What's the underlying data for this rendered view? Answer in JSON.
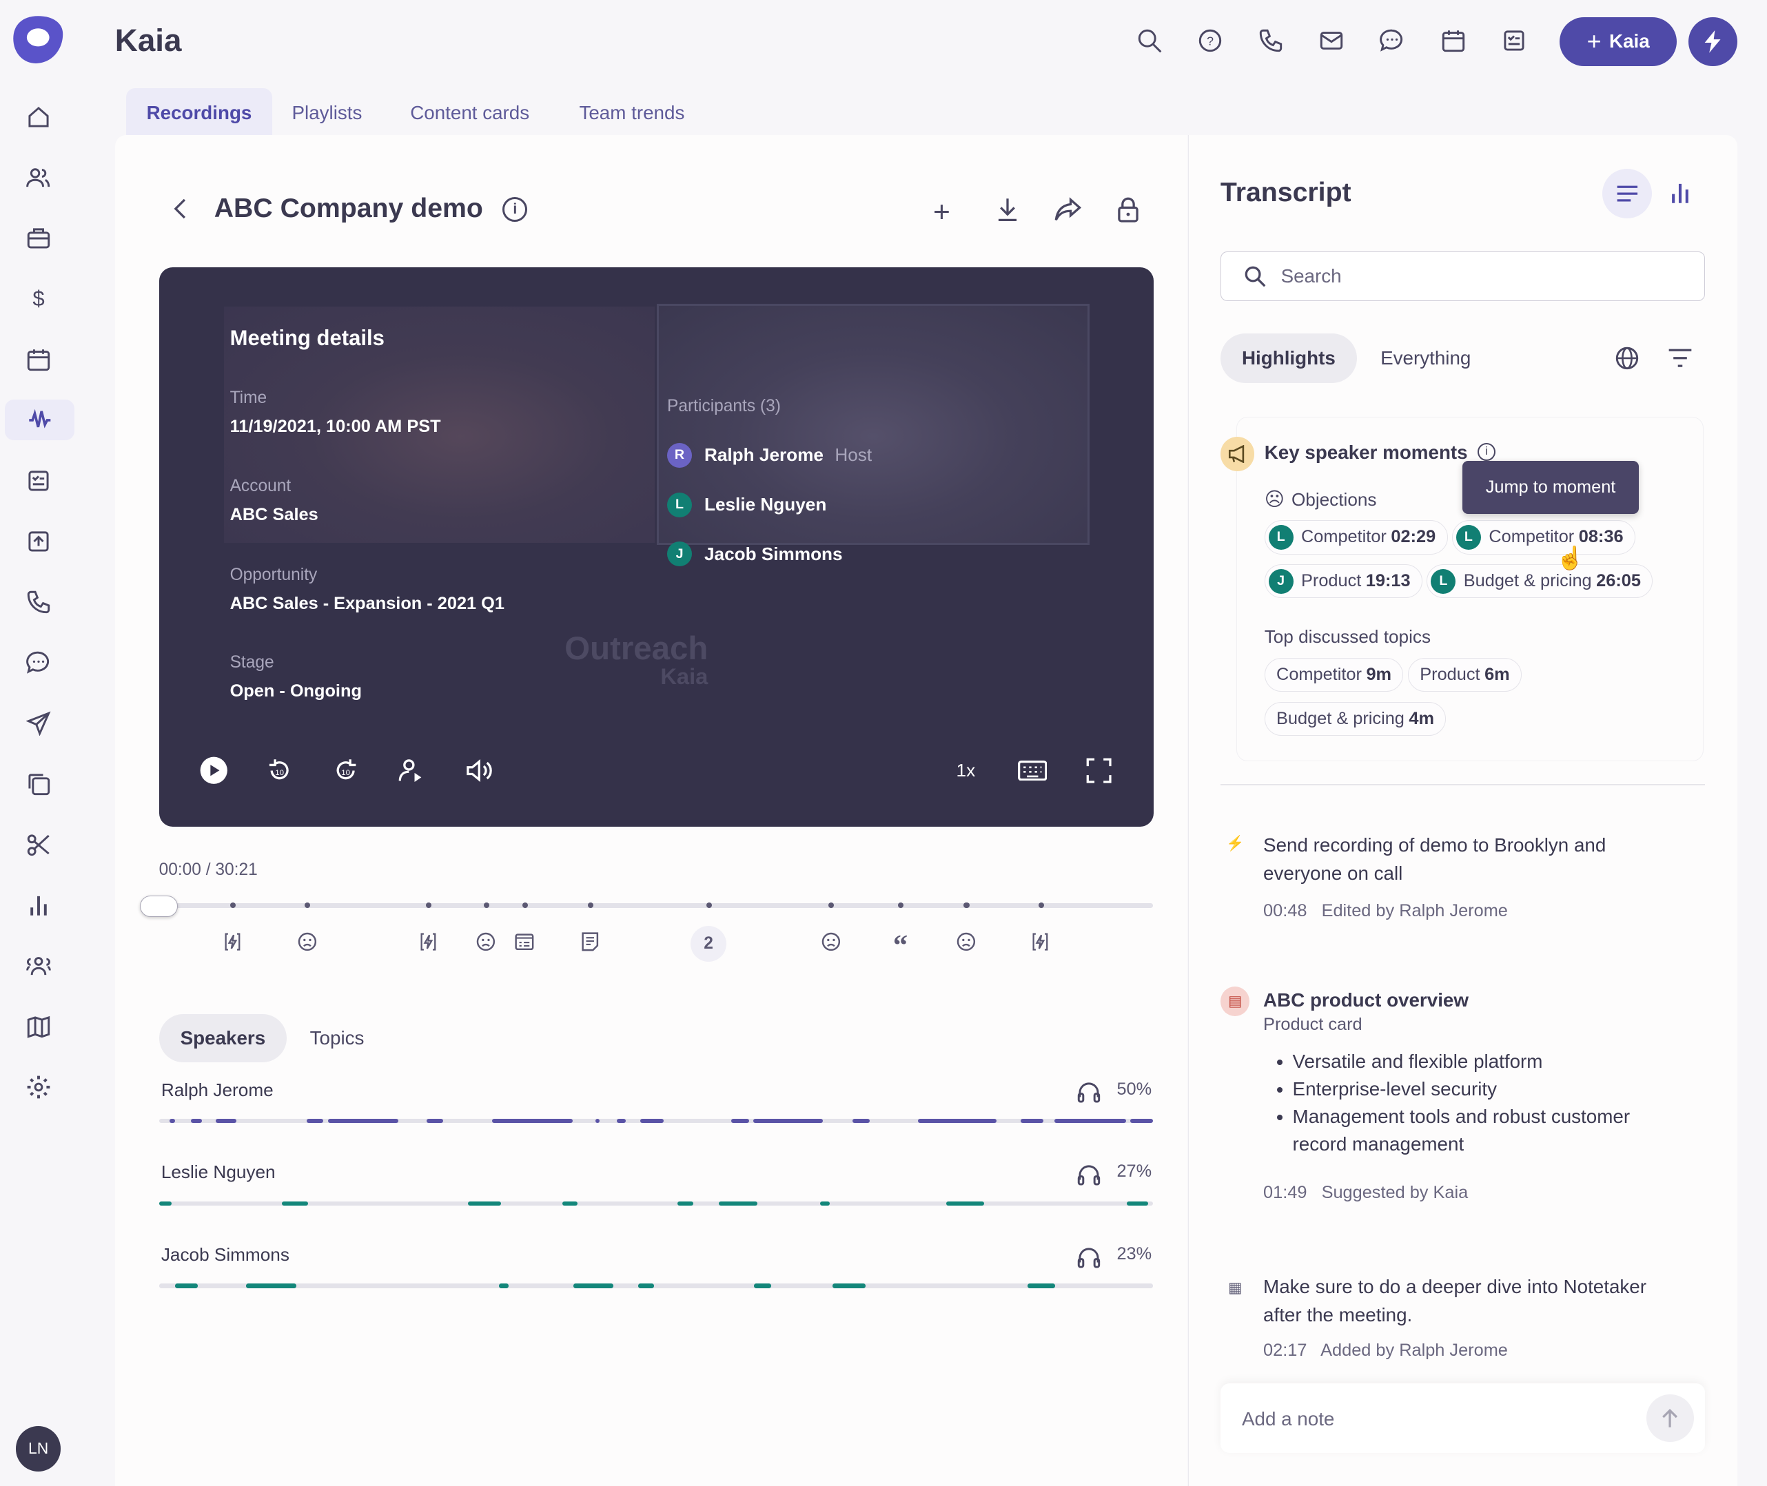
{
  "app": {
    "title": "Kaia",
    "kaia_button": "Kaia",
    "user_initials": "LN"
  },
  "tabs": [
    {
      "label": "Recordings"
    },
    {
      "label": "Playlists"
    },
    {
      "label": "Content cards"
    },
    {
      "label": "Team trends"
    }
  ],
  "recording": {
    "title": "ABC Company demo",
    "current_time": "00:00",
    "separator": "/",
    "duration": "30:21",
    "speed": "1x"
  },
  "meeting": {
    "heading": "Meeting details",
    "time_label": "Time",
    "time_value": "11/19/2021, 10:00 AM PST",
    "account_label": "Account",
    "account_value": "ABC Sales",
    "opportunity_label": "Opportunity",
    "opportunity_value": "ABC Sales - Expansion - 2021 Q1",
    "stage_label": "Stage",
    "stage_value": "Open - Ongoing",
    "participants_label": "Participants (3)",
    "participants": [
      {
        "initial": "R",
        "name": "Ralph Jerome",
        "role": "Host",
        "color": "#6b63c4"
      },
      {
        "initial": "L",
        "name": "Leslie Nguyen",
        "role": "",
        "color": "#117f73"
      },
      {
        "initial": "J",
        "name": "Jacob Simmons",
        "role": "",
        "color": "#117f73"
      }
    ],
    "watermark": "Outreach",
    "watermark_sub": "Kaia"
  },
  "timeline": {
    "markers": [
      {
        "pct": 7.4,
        "icon": "bolt"
      },
      {
        "pct": 14.9,
        "icon": "frown"
      },
      {
        "pct": 27.1,
        "icon": "bolt"
      },
      {
        "pct": 32.9,
        "icon": "frown"
      },
      {
        "pct": 36.8,
        "icon": "card"
      },
      {
        "pct": 43.4,
        "icon": "note"
      },
      {
        "pct": 55.3,
        "icon": "2"
      },
      {
        "pct": 67.6,
        "icon": "frown"
      },
      {
        "pct": 74.6,
        "icon": "quote"
      },
      {
        "pct": 81.2,
        "icon": "frown"
      },
      {
        "pct": 88.7,
        "icon": "bolt"
      }
    ]
  },
  "speakers_tabs": {
    "speakers": "Speakers",
    "topics": "Topics"
  },
  "speakers": [
    {
      "name": "Ralph Jerome",
      "pct": "50%",
      "color": "#5a53a6",
      "segments": [
        [
          1.1,
          1.6
        ],
        [
          3.2,
          4.3
        ],
        [
          5.7,
          7.8
        ],
        [
          14.9,
          16.5
        ],
        [
          17,
          24.1
        ],
        [
          26.9,
          28.6
        ],
        [
          33.5,
          41.6
        ],
        [
          43.9,
          44.3
        ],
        [
          46.1,
          47
        ],
        [
          48.4,
          50.8
        ],
        [
          57.6,
          59.4
        ],
        [
          59.8,
          66.8
        ],
        [
          69.8,
          71.5
        ],
        [
          76.4,
          84.3
        ],
        [
          86.7,
          89
        ],
        [
          90.1,
          97.3
        ],
        [
          97.7,
          100
        ]
      ]
    },
    {
      "name": "Leslie Nguyen",
      "pct": "27%",
      "color": "#13867a",
      "segments": [
        [
          0,
          1.3
        ],
        [
          12.4,
          15
        ],
        [
          31.1,
          34.4
        ],
        [
          40.6,
          42.1
        ],
        [
          52.2,
          53.8
        ],
        [
          56.3,
          60.2
        ],
        [
          66.5,
          67.5
        ],
        [
          79.2,
          83
        ],
        [
          97.4,
          99.5
        ]
      ]
    },
    {
      "name": "Jacob Simmons",
      "pct": "23%",
      "color": "#13867a",
      "segments": [
        [
          1.6,
          3.9
        ],
        [
          8.8,
          13.8
        ],
        [
          34.2,
          35.2
        ],
        [
          41.7,
          45.7
        ],
        [
          48.2,
          49.8
        ],
        [
          59.9,
          61.6
        ],
        [
          67.8,
          71.1
        ],
        [
          87.4,
          90.2
        ]
      ]
    }
  ],
  "transcript": {
    "title": "Transcript",
    "search_placeholder": "Search",
    "tab_highlights": "Highlights",
    "tab_everything": "Everything",
    "key_moments": {
      "title": "Key speaker moments",
      "tooltip": "Jump to moment",
      "objections_label": "Objections",
      "objections": [
        {
          "initial": "L",
          "label": "Competitor",
          "time": "02:29"
        },
        {
          "initial": "L",
          "label": "Competitor",
          "time": "08:36"
        },
        {
          "initial": "J",
          "label": "Product",
          "time": "19:13"
        },
        {
          "initial": "L",
          "label": "Budget & pricing",
          "time": "26:05"
        }
      ],
      "topics_label": "Top discussed topics",
      "topics": [
        {
          "label": "Competitor",
          "time": "9m"
        },
        {
          "label": "Product",
          "time": "6m"
        },
        {
          "label": "Budget & pricing",
          "time": "4m"
        }
      ]
    },
    "items": [
      {
        "text": "Send recording of demo to Brooklyn and everyone on call",
        "time": "00:48",
        "meta": "Edited by Ralph Jerome"
      },
      {
        "title": "ABC product overview",
        "subtitle": "Product card",
        "bullets": [
          "Versatile and flexible platform",
          "Enterprise-level security",
          "Management tools and robust customer record management"
        ],
        "time": "01:49",
        "meta": "Suggested by Kaia"
      },
      {
        "text": "Make sure to do a deeper dive into Notetaker after the meeting.",
        "time": "02:17",
        "meta": "Added by Ralph Jerome"
      }
    ],
    "note_placeholder": "Add a note"
  },
  "colors": {
    "accent": "#4f4aa8",
    "teal": "#117f73",
    "video_bg": "#35324a"
  }
}
